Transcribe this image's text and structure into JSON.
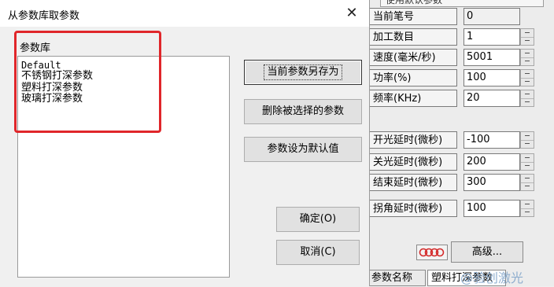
{
  "dialog": {
    "title": "从参数库取参数",
    "close_glyph": "✕",
    "group_label": "参数库",
    "list_items": [
      "Default",
      "不锈钢打深参数",
      "塑料打深参数",
      "玻璃打深参数"
    ],
    "buttons": {
      "save_as": "当前参数另存为",
      "delete": "删除被选择的参数",
      "set_default": "参数设为默认值",
      "ok": "确定(O)",
      "cancel": "取消(C)"
    },
    "highlight_color": "#e0262a"
  },
  "panel": {
    "top_strip": "使用默认参数",
    "rows": [
      {
        "label": "当前笔号",
        "value": "0"
      },
      {
        "label": "加工数目",
        "value": "1"
      },
      {
        "label": "速度(毫米/秒)",
        "value": "5001"
      },
      {
        "label": "功率(%)",
        "value": "100"
      },
      {
        "label": "频率(KHz)",
        "value": "20"
      },
      {
        "label": "开光延时(微秒)",
        "value": "-100"
      },
      {
        "label": "关光延时(微秒)",
        "value": "200"
      },
      {
        "label": "结束延时(微秒)",
        "value": "300"
      },
      {
        "label": "拐角延时(微秒)",
        "value": "100"
      }
    ],
    "advanced_button": "高级...",
    "laser_icon": "laser-icon",
    "tabs": [
      "参数名称",
      "塑料打深参数"
    ],
    "watermark": "@验创激光"
  }
}
